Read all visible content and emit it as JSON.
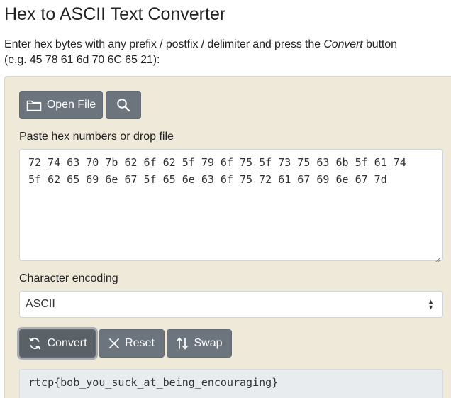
{
  "page": {
    "title": "Hex to ASCII Text Converter",
    "intro_before": "Enter hex bytes with any prefix / postfix / delimiter and press the ",
    "intro_emphasis": "Convert",
    "intro_after": " button",
    "intro_example": "(e.g. 45 78 61 6d 70 6C 65 21):"
  },
  "toolbar": {
    "open_file_label": "Open File",
    "open_file_icon": "folder-icon",
    "search_icon": "search-icon"
  },
  "input": {
    "label": "Paste hex numbers or drop file",
    "value": "72 74 63 70 7b 62 6f 62 5f 79 6f 75 5f 73 75 63 6b 5f 61 74\n5f 62 65 69 6e 67 5f 65 6e 63 6f 75 72 61 67 69 6e 67 7d"
  },
  "encoding": {
    "label": "Character encoding",
    "selected": "ASCII"
  },
  "actions": {
    "convert_label": "Convert",
    "reset_label": "Reset",
    "swap_label": "Swap"
  },
  "output": {
    "value": "rtcp{bob_you_suck_at_being_encouraging}"
  },
  "colors": {
    "panel_background": "#efe9da",
    "button_background": "#6c757d",
    "output_background": "#e9ecef"
  }
}
